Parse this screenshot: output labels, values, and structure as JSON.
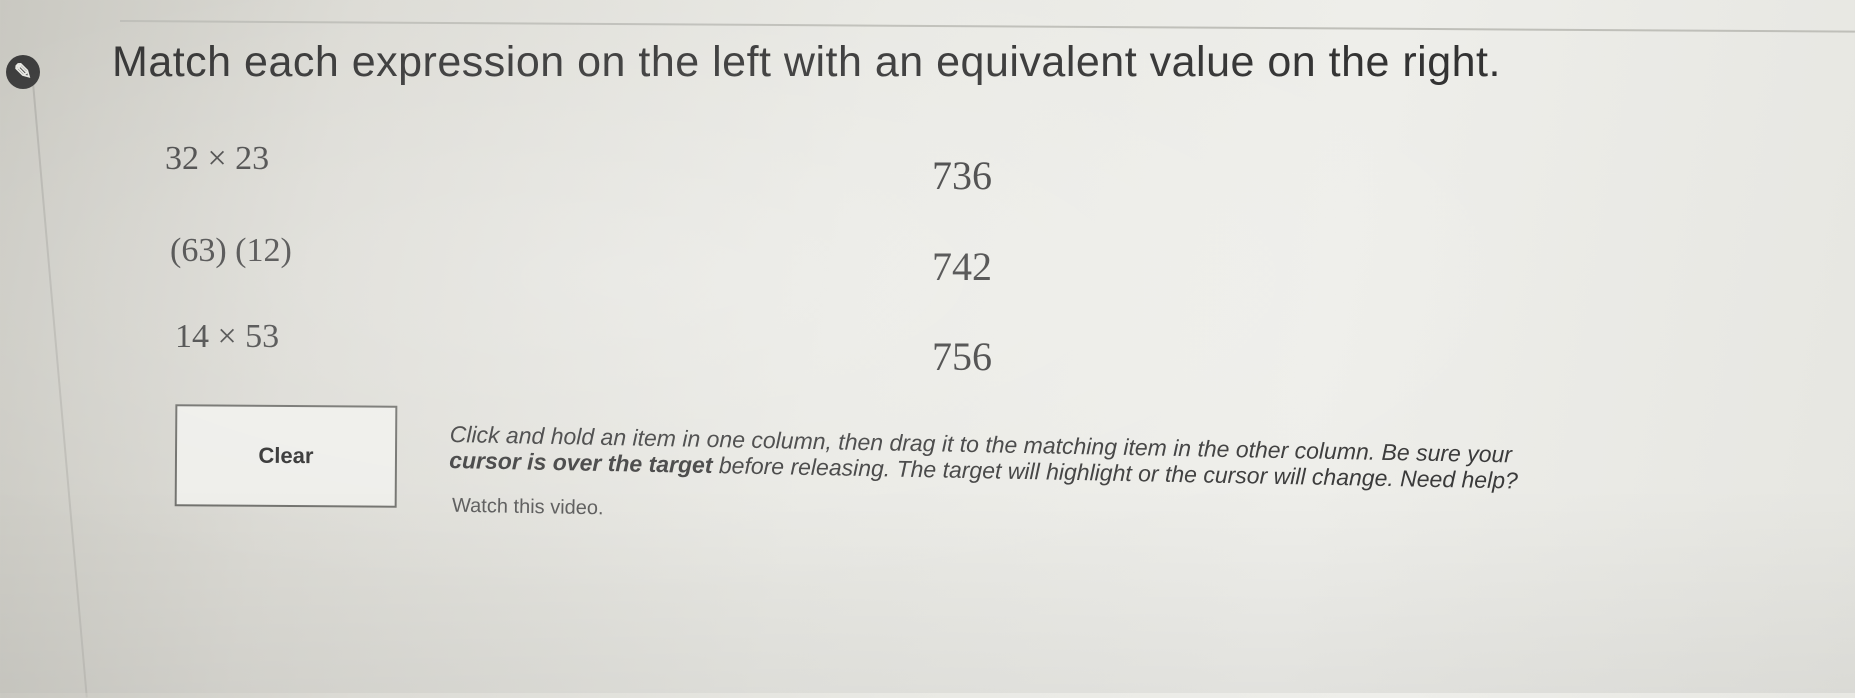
{
  "question": {
    "icon": "pencil-icon",
    "text": "Match each expression on the left with an equivalent value on the right."
  },
  "left_items": [
    {
      "label": "32 × 23"
    },
    {
      "label": "(63) (12)"
    },
    {
      "label": "14 × 53"
    }
  ],
  "right_items": [
    {
      "label": "736"
    },
    {
      "label": "742"
    },
    {
      "label": "756"
    }
  ],
  "clear_button": {
    "label": "Clear"
  },
  "instructions": {
    "line1": "Click and hold an item in one column, then drag it to the matching item in the other column. Be sure your",
    "line2_bold": "cursor is over the target",
    "line2_rest": " before releasing. The target will highlight or the cursor will change. Need help?",
    "watch_video": "Watch this video."
  },
  "colors": {
    "background": "#e9e9e4",
    "text": "#333333",
    "button_border": "#6e6e6a"
  }
}
